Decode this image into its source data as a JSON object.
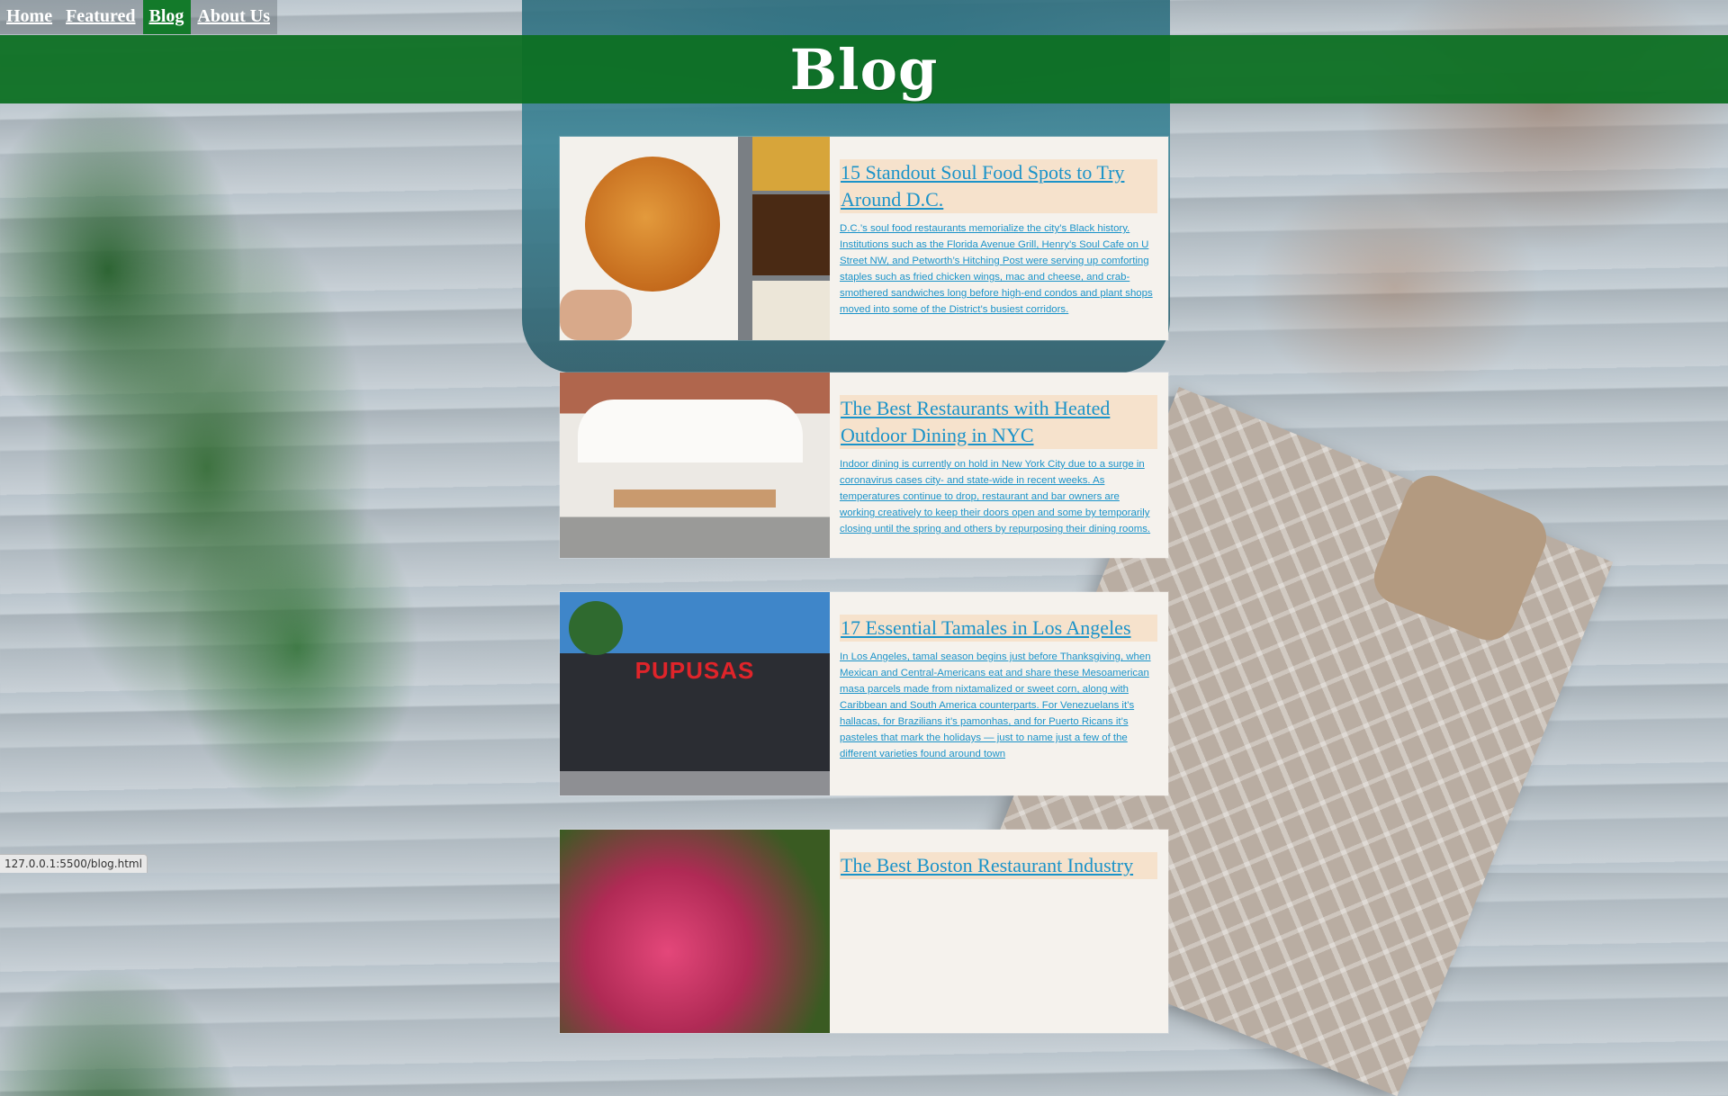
{
  "nav": {
    "items": [
      {
        "label": "Home",
        "active": false
      },
      {
        "label": "Featured",
        "active": false
      },
      {
        "label": "Blog",
        "active": true
      },
      {
        "label": "About Us",
        "active": false
      }
    ]
  },
  "header": {
    "title": "Blog"
  },
  "posts": [
    {
      "title": "15 Standout Soul Food Spots to Try Around D.C.",
      "excerpt": "D.C.’s soul food restaurants memorialize the city’s Black history. Institutions such as the Florida Avenue Grill, Henry’s Soul Cafe on U Street NW, and Petworth’s Hitching Post were serving up comforting staples such as fried chicken wings, mac and cheese, and crab-smothered sandwiches long before high-end condos and plant shops moved into some of the District’s busiest corridors."
    },
    {
      "title": "The Best Restaurants with Heated Outdoor Dining in NYC",
      "excerpt": "Indoor dining is currently on hold in New York City due to a surge in coronavirus cases city- and state-wide in recent weeks. As temperatures continue to drop, restaurant and bar owners are working creatively to keep their doors open and some by temporarily closing until the spring and others by repurposing their dining rooms."
    },
    {
      "title": "17 Essential Tamales in Los Angeles",
      "excerpt": "In Los Angeles, tamal season begins just before Thanksgiving, when Mexican and Central-Americans eat and share these Mesoamerican masa parcels made from nixtamalized or sweet corn, along with Caribbean and South America counterparts. For Venezuelans it’s hallacas, for Brazilians it’s pamonhas, and for Puerto Ricans it’s pasteles that mark the holidays — just to name just a few of the different varieties found around town"
    },
    {
      "title": "The Best Boston Restaurant Industry",
      "excerpt": ""
    }
  ],
  "thumbs": {
    "truck_sign": "PUPUSAS"
  },
  "status_bar": {
    "url": "127.0.0.1:5500/blog.html"
  },
  "colors": {
    "banner": "#0d7023",
    "nav_active": "#137a2a",
    "link": "#1b93c9",
    "title_bg": "#f6e2cc",
    "card_bg": "#f5f2ed"
  }
}
